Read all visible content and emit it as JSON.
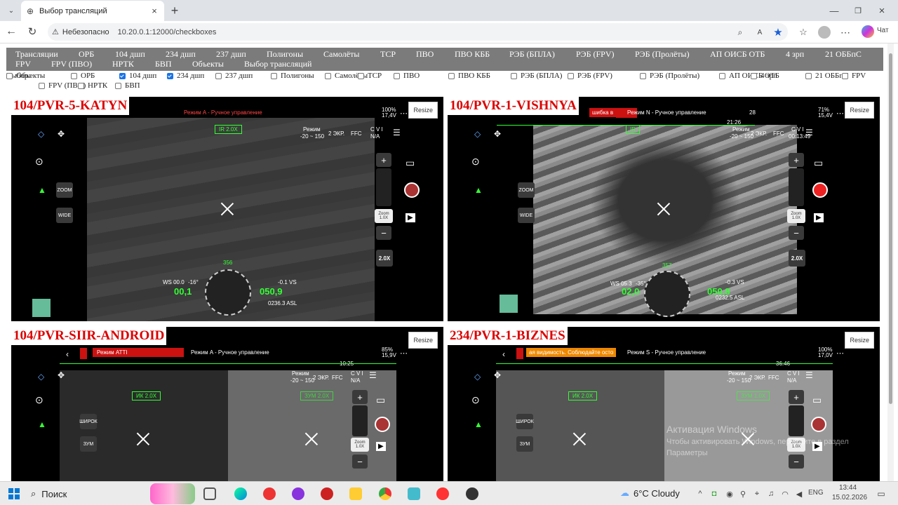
{
  "browser": {
    "tab_title": "Выбор трансляций",
    "security_label": "Небезопасно",
    "url": "10.20.0.1:12000/checkboxes",
    "copilot_label": "Чат"
  },
  "nav": {
    "links": [
      "Трансляции",
      "ОРБ",
      "104 дшп",
      "234 дшп",
      "237 дшп",
      "Полигоны",
      "Самолёты",
      "ТСР",
      "ПВО",
      "ПВО КББ",
      "РЭБ (БПЛА)",
      "РЭБ (FPV)",
      "РЭБ (Пролёты)",
      "АП ОИСБ ОТБ",
      "4 зрп",
      "21 ОББпС",
      "FPV",
      "FPV (ПВО)",
      "НРТК",
      "БВП",
      "Объекты",
      "Выбор трансляций"
    ]
  },
  "selection": {
    "label": "Выбор:",
    "items": [
      {
        "label": "ОРБ",
        "checked": false
      },
      {
        "label": "104 дшп",
        "checked": true
      },
      {
        "label": "234 дшп",
        "checked": true
      },
      {
        "label": "237 дшп",
        "checked": false
      },
      {
        "label": "Полигоны",
        "checked": false
      },
      {
        "label": "Самолёты",
        "checked": false
      },
      {
        "label": "ТСР",
        "checked": false
      },
      {
        "label": "ПВО",
        "checked": false
      },
      {
        "label": "ПВО КББ",
        "checked": false
      },
      {
        "label": "РЭБ (БПЛА)",
        "checked": false
      },
      {
        "label": "РЭБ (FPV)",
        "checked": false
      },
      {
        "label": "РЭБ (Пролёты)",
        "checked": false
      },
      {
        "label": "АП ОИСБ ОТБ",
        "checked": false
      },
      {
        "label": "4 зрп",
        "checked": false
      },
      {
        "label": "21 ОББпС",
        "checked": false
      },
      {
        "label": "FPV",
        "checked": false
      },
      {
        "label": "FPV (ПВО)",
        "checked": false
      },
      {
        "label": "НРТК",
        "checked": false
      },
      {
        "label": "БВП",
        "checked": false
      },
      {
        "label": "Объекты",
        "checked": false
      }
    ]
  },
  "streams": [
    {
      "title": "104/PVR-5-KATYN",
      "resize": "Resize",
      "mode": "Режим A - Ручное управление",
      "zoom_label": "ZOOM",
      "wide_label": "WIDE",
      "ir": "IR 2.0X",
      "exposure": "Режим",
      "range": "-20 ~ 150",
      "screens": "2 ЭКР.",
      "ffc": "FFC",
      "cvi": "C V I",
      "na": "N/A",
      "zoom_badge": "Zoom",
      "zoom_val": "1.0X",
      "ir_side": "2.0X",
      "battery": "100%",
      "voltage": "17,4V",
      "ws": "WS 00.0",
      "speed": "00,1",
      "alt": "050,9",
      "vs": "-0.1 VS",
      "asl": "0236.3 ASL",
      "heading": "356",
      "pitch": "-16°"
    },
    {
      "title": "104/PVR-1-VISHNYA",
      "resize": "Resize",
      "mode": "Режим N - Ручное управление",
      "warning": "шибка в",
      "zoom_label": "ZOOM",
      "wide_label": "WIDE",
      "ir": "IR",
      "exposure": "Режим",
      "range": "-20 ~ 150",
      "screens": "2 ЭКР.",
      "ffc": "FFC",
      "cvi": "C V I",
      "na": "00:13:49",
      "zoom_badge": "Zoom",
      "zoom_val": "1.0X",
      "ir_side": "2.0X",
      "battery": "71%",
      "voltage": "15,4V",
      "ws": "WS 05.3",
      "speed": "02,0",
      "alt": "050,8",
      "vs": "-0.3 VS",
      "asl": "0232.5 ASL",
      "heading": "357",
      "pitch": "-35°",
      "timer": "21:26",
      "sats": "28"
    },
    {
      "title": "104/PVR-SIIR-ANDROID",
      "resize": "Resize",
      "mode": "Режим A - Ручное управление",
      "mode2": "Режим ATTI",
      "zoom_label": "ЗУМ",
      "wide_label": "ШИРОК",
      "ir": "ИК 2.0X",
      "ir2": "ЗУМ 2.0X",
      "exposure": "Режим",
      "range": "-20 ~ 150",
      "screens": "2 ЭКР.",
      "ffc": "FFC",
      "cvi": "C V I",
      "na": "N/A",
      "zoom_badge": "Zoom",
      "zoom_val": "1.0X",
      "battery": "85%",
      "voltage": "15,9V",
      "timer": "10:25"
    },
    {
      "title": "234/PVR-1-BIZNES",
      "resize": "Resize",
      "mode": "Режим S - Ручное управление",
      "warning": "ая видимость. Соблюдайте осто",
      "zoom_label": "ЗУМ",
      "wide_label": "ШИРОК",
      "ir": "ИК 2.0X",
      "ir2": "ЗУМ 1.0X",
      "exposure": "Режим",
      "range": "-20 ~ 150",
      "screens": "2 ЭКР.",
      "ffc": "FFC",
      "cvi": "C V I",
      "na": "N/A",
      "zoom_badge": "Zoom",
      "zoom_val": "1.0X",
      "battery": "100%",
      "voltage": "17,0V",
      "timer": "36:46",
      "activate": "Активация Windows",
      "activate_sub": "Чтобы активировать Windows, перейдите в раздел",
      "params": "Параметры"
    }
  ],
  "taskbar": {
    "search": "Поиск",
    "weather": "6°C  Cloudy",
    "lang": "ENG",
    "time": "13:44",
    "date": "15.02.2026"
  }
}
